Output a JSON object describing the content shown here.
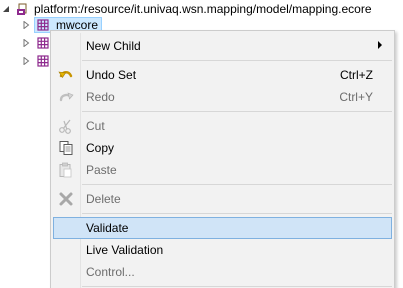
{
  "tree": {
    "root_label": "platform:/resource/it.univaq.wsn.mapping/model/mapping.ecore",
    "selected_label": "mwcore"
  },
  "menu": {
    "items": [
      {
        "label": "New Child",
        "shortcut": "",
        "enabled": true,
        "icon": "none",
        "submenu": true
      },
      {
        "label": "Undo Set",
        "shortcut": "Ctrl+Z",
        "enabled": true,
        "icon": "undo-icon"
      },
      {
        "label": "Redo",
        "shortcut": "Ctrl+Y",
        "enabled": false,
        "icon": "redo-icon"
      },
      {
        "label": "Cut",
        "shortcut": "",
        "enabled": false,
        "icon": "scissors-icon"
      },
      {
        "label": "Copy",
        "shortcut": "",
        "enabled": true,
        "icon": "copy-icon"
      },
      {
        "label": "Paste",
        "shortcut": "",
        "enabled": false,
        "icon": "paste-icon"
      },
      {
        "label": "Delete",
        "shortcut": "",
        "enabled": false,
        "icon": "delete-icon"
      },
      {
        "label": "Validate",
        "shortcut": "",
        "enabled": true,
        "icon": "none",
        "highlighted": true
      },
      {
        "label": "Live Validation",
        "shortcut": "",
        "enabled": true,
        "icon": "none"
      },
      {
        "label": "Control...",
        "shortcut": "",
        "enabled": false,
        "icon": "none"
      }
    ]
  },
  "colors": {
    "selection_bg": "#cce8ff",
    "highlight_bg": "#d0e4f7",
    "menu_bg": "#f2f2f2",
    "disabled_text": "#6d6d6d",
    "package_icon": "#8e2a8e"
  }
}
